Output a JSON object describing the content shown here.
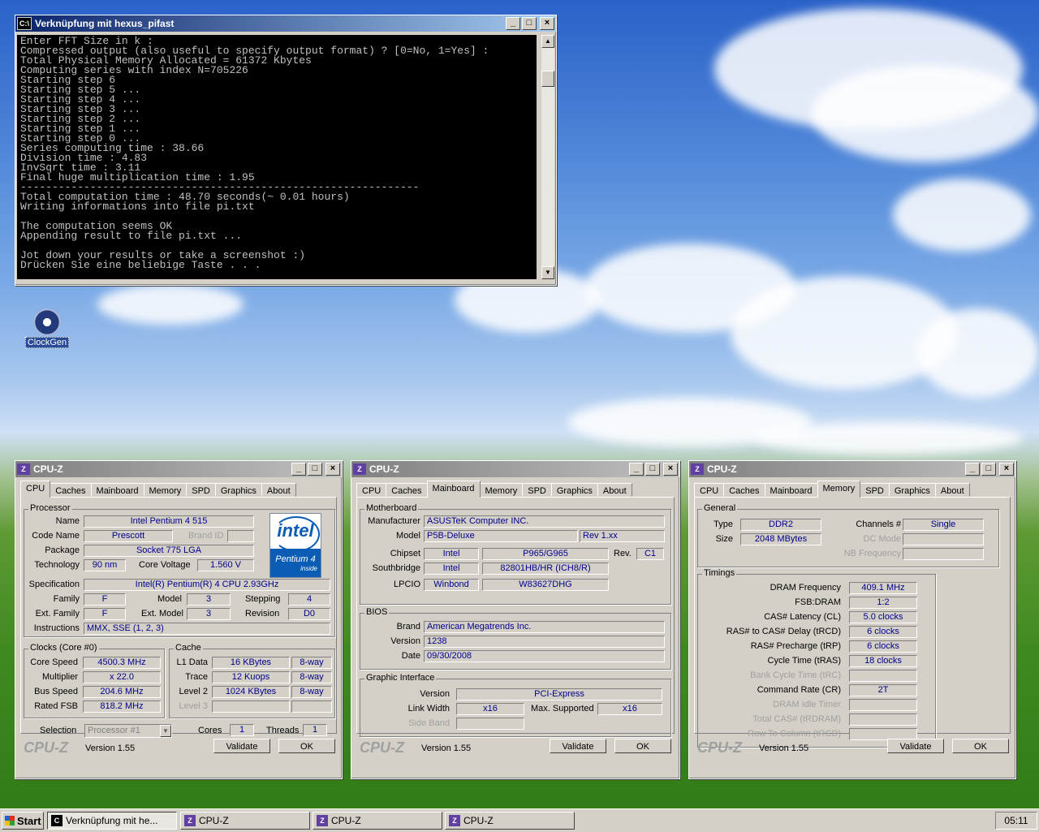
{
  "desktop": {
    "icons": [
      {
        "label": "ClockGen",
        "icon": "clock-gear-icon"
      }
    ]
  },
  "console": {
    "title": "Verknüpfung mit hexus_pifast",
    "lines": [
      "Enter FFT Size in k :",
      "Compressed output (also useful to specify output format) ? [0=No, 1=Yes] :",
      "Total Physical Memory Allocated = 61372 Kbytes",
      "Computing series with index N=705226",
      "Starting step 6",
      "Starting step 5 ...",
      "Starting step 4 ...",
      "Starting step 3 ...",
      "Starting step 2 ...",
      "Starting step 1 ...",
      "Starting step 0 ...",
      "Series computing time : 38.66",
      "Division time : 4.83",
      "InvSqrt time : 3.11",
      "Final huge multiplication time : 1.95",
      "---------------------------------------------------------------",
      "Total computation time : 48.70 seconds(~ 0.01 hours)",
      "Writing informations into file pi.txt",
      "",
      "The computation seems OK",
      "Appending result to file pi.txt ...",
      "",
      "Jot down your results or take a screenshot :)",
      "Drücken Sie eine beliebige Taste . . ."
    ]
  },
  "cpuz_common": {
    "title": "CPU-Z",
    "tabs": [
      "CPU",
      "Caches",
      "Mainboard",
      "Memory",
      "SPD",
      "Graphics",
      "About"
    ],
    "brand": "CPU-Z",
    "version": "Version 1.55",
    "validate": "Validate",
    "ok": "OK"
  },
  "cpu": {
    "processor_group": "Processor",
    "name_l": "Name",
    "name": "Intel Pentium 4 515",
    "codename_l": "Code Name",
    "codename": "Prescott",
    "brandid_l": "Brand ID",
    "package_l": "Package",
    "package": "Socket 775 LGA",
    "tech_l": "Technology",
    "tech": "90 nm",
    "cv_l": "Core Voltage",
    "cv": "1.560 V",
    "spec_l": "Specification",
    "spec": "Intel(R) Pentium(R) 4 CPU 2.93GHz",
    "family_l": "Family",
    "family": "F",
    "model_l": "Model",
    "model": "3",
    "stepping_l": "Stepping",
    "stepping": "4",
    "extfamily_l": "Ext. Family",
    "extfamily": "F",
    "extmodel_l": "Ext. Model",
    "extmodel": "3",
    "revision_l": "Revision",
    "revision": "D0",
    "instr_l": "Instructions",
    "instr": "MMX, SSE (1, 2, 3)",
    "logo": {
      "brand": "intel",
      "line": "Pentium 4",
      "sub": "inside"
    },
    "clocks_group": "Clocks (Core #0)",
    "corespeed_l": "Core Speed",
    "corespeed": "4500.3 MHz",
    "mult_l": "Multiplier",
    "mult": "x 22.0",
    "bus_l": "Bus Speed",
    "bus": "204.6 MHz",
    "fsb_l": "Rated FSB",
    "fsb": "818.2 MHz",
    "cache_group": "Cache",
    "l1_l": "L1 Data",
    "l1": "16 KBytes",
    "l1w": "8-way",
    "trace_l": "Trace",
    "trace": "12 Kuops",
    "tracew": "8-way",
    "l2_l": "Level 2",
    "l2": "1024 KBytes",
    "l2w": "8-way",
    "l3_l": "Level 3",
    "selection_l": "Selection",
    "selection": "Processor #1",
    "cores_l": "Cores",
    "cores": "1",
    "threads_l": "Threads",
    "threads": "1"
  },
  "mainboard": {
    "mb_group": "Motherboard",
    "manu_l": "Manufacturer",
    "manu": "ASUSTeK Computer INC.",
    "model_l": "Model",
    "model": "P5B-Deluxe",
    "rev": "Rev 1.xx",
    "chipset_l": "Chipset",
    "chipset_v": "Intel",
    "chipset": "P965/G965",
    "chiprev_l": "Rev.",
    "chiprev": "C1",
    "south_l": "Southbridge",
    "south_v": "Intel",
    "south": "82801HB/HR (ICH8/R)",
    "lpcio_l": "LPCIO",
    "lpcio_v": "Winbond",
    "lpcio": "W83627DHG",
    "bios_group": "BIOS",
    "brand_l": "Brand",
    "brand": "American Megatrends Inc.",
    "version_l": "Version",
    "version": "1238",
    "date_l": "Date",
    "date": "09/30/2008",
    "gi_group": "Graphic Interface",
    "giver_l": "Version",
    "giver": "PCI-Express",
    "lw_l": "Link Width",
    "lw": "x16",
    "ms_l": "Max. Supported",
    "ms": "x16",
    "sb_l": "Side Band"
  },
  "memory": {
    "general_group": "General",
    "type_l": "Type",
    "type": "DDR2",
    "channels_l": "Channels #",
    "channels": "Single",
    "size_l": "Size",
    "size": "2048 MBytes",
    "dc_l": "DC Mode",
    "nb_l": "NB Frequency",
    "timings_group": "Timings",
    "dram_l": "DRAM Frequency",
    "dram": "409.1 MHz",
    "fsbdram_l": "FSB:DRAM",
    "fsbdram": "1:2",
    "cl_l": "CAS# Latency (CL)",
    "cl": "5.0 clocks",
    "trcd_l": "RAS# to CAS# Delay (tRCD)",
    "trcd": "6 clocks",
    "trp_l": "RAS# Precharge (tRP)",
    "trp": "6 clocks",
    "tras_l": "Cycle Time (tRAS)",
    "tras": "18 clocks",
    "trc_l": "Bank Cycle Time (tRC)",
    "cr_l": "Command Rate (CR)",
    "cr": "2T",
    "idle_l": "DRAM Idle Timer",
    "tcas_l": "Total CAS# (tRDRAM)",
    "rtc_l": "Row To Column (tRCD)"
  },
  "taskbar": {
    "start": "Start",
    "items": [
      "Verknüpfung mit he...",
      "CPU-Z",
      "CPU-Z",
      "CPU-Z"
    ],
    "clock": "05:11"
  }
}
